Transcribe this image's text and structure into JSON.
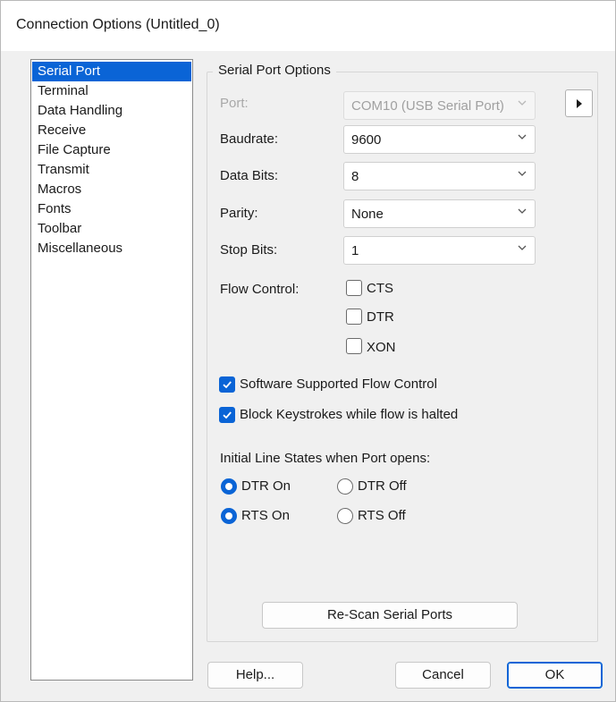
{
  "window": {
    "title": "Connection Options (Untitled_0)"
  },
  "categories": [
    {
      "label": "Serial Port",
      "selected": true
    },
    {
      "label": "Terminal",
      "selected": false
    },
    {
      "label": "Data Handling",
      "selected": false
    },
    {
      "label": "Receive",
      "selected": false
    },
    {
      "label": "File Capture",
      "selected": false
    },
    {
      "label": "Transmit",
      "selected": false
    },
    {
      "label": "Macros",
      "selected": false
    },
    {
      "label": "Fonts",
      "selected": false
    },
    {
      "label": "Toolbar",
      "selected": false
    },
    {
      "label": "Miscellaneous",
      "selected": false
    }
  ],
  "serial": {
    "group_title": "Serial Port Options",
    "port_label": "Port:",
    "port_value": "COM10 (USB Serial Port)",
    "baudrate_label": "Baudrate:",
    "baudrate_value": "9600",
    "databits_label": "Data Bits:",
    "databits_value": "8",
    "parity_label": "Parity:",
    "parity_value": "None",
    "stopbits_label": "Stop Bits:",
    "stopbits_value": "1",
    "flow_label": "Flow Control:",
    "flow": [
      {
        "label": "CTS",
        "checked": false
      },
      {
        "label": "DTR",
        "checked": false
      },
      {
        "label": "XON",
        "checked": false
      }
    ],
    "software_flow_label": "Software Supported Flow Control",
    "software_flow_checked": true,
    "block_keys_label": "Block Keystrokes while flow is halted",
    "block_keys_checked": true,
    "line_states_label": "Initial Line States when Port opens:",
    "dtr_on": "DTR On",
    "dtr_off": "DTR Off",
    "rts_on": "RTS On",
    "rts_off": "RTS Off",
    "dtr_state": "on",
    "rts_state": "on",
    "rescan_label": "Re-Scan Serial Ports"
  },
  "buttons": {
    "help": "Help...",
    "cancel": "Cancel",
    "ok": "OK"
  },
  "colors": {
    "accent": "#0a64d6",
    "background": "#f0f0f0"
  }
}
